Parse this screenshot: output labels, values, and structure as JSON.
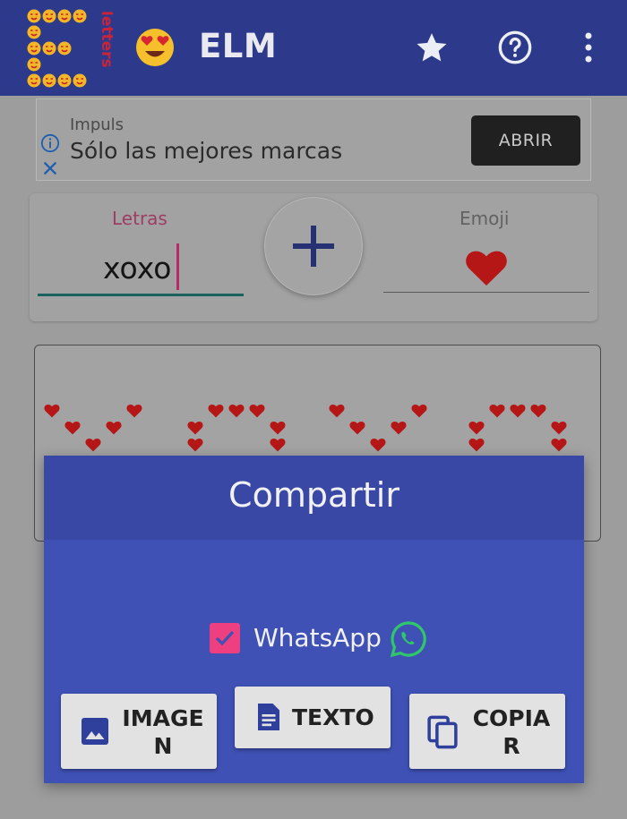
{
  "app_bar": {
    "title": "ELM",
    "logo_letter": "E",
    "logo_word": "letters",
    "logo_emoji": "heart-eyes-face",
    "star_icon": "star-icon",
    "help_icon": "help-circle-icon",
    "menu_icon": "more-vert-icon",
    "color": "#2d3a8c"
  },
  "ad": {
    "brand": "Impuls",
    "text": "Sólo las mejores marcas",
    "button_label": "ABRIR"
  },
  "input_card": {
    "letters_label": "Letras",
    "letters_value": "xoxo",
    "emoji_label": "Emoji",
    "emoji_value": "heart",
    "add_icon": "plus-icon"
  },
  "result": {
    "text": "xoxo",
    "emoji": "heart",
    "emoji_color": "#b51616"
  },
  "share_dialog": {
    "title": "Compartir",
    "whatsapp_label": "WhatsApp",
    "whatsapp_checked": true,
    "buttons": [
      {
        "label": "IMAGE\nN",
        "line1": "IMAGE",
        "line2": "N",
        "icon": "image-icon"
      },
      {
        "label": "TEXTO",
        "icon": "document-icon"
      },
      {
        "label": "COPIA\nR",
        "line1": "COPIA",
        "line2": "R",
        "icon": "copy-icon"
      }
    ],
    "accent": "#3f51b5",
    "checkbox_color": "#ee4080"
  }
}
